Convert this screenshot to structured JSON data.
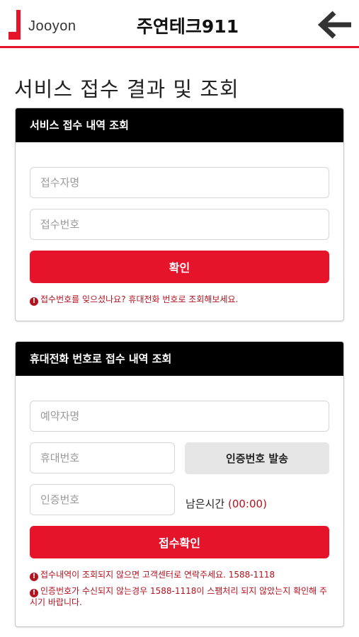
{
  "header": {
    "logo_text": "Jooyon",
    "brand_title": "주연테크911",
    "back_icon": "arrow-left-icon",
    "accent_color": "#e5142b"
  },
  "page_title": "서비스 접수 결과 및 조회",
  "receipt_lookup": {
    "heading": "서비스 접수 내역 조회",
    "name_placeholder": "접수자명",
    "receipt_no_placeholder": "접수번호",
    "confirm_label": "확인",
    "notice_icon": "exclamation-circle-icon",
    "notice": "접수번호를 잊으셨나요? 휴대전화 번호로 조회해보세요."
  },
  "phone_lookup": {
    "heading": "휴대전화 번호로 접수 내역 조회",
    "reserver_placeholder": "예약자명",
    "phone_placeholder": "휴대번호",
    "send_code_label": "인증번호 발송",
    "code_placeholder": "인증번호",
    "timer_label": "남은시간",
    "timer_value": "(00:00)",
    "confirm_label": "접수확인",
    "notice_icon": "exclamation-circle-icon",
    "notices": [
      "접수내역이 조회되지 않으면 고객센터로 연락주세요. 1588-1118",
      "인증번호가 수신되지 않는경우 1588-1118이 스팸처리 되지 않았는지 확인해 주시기 바랍니다."
    ]
  }
}
